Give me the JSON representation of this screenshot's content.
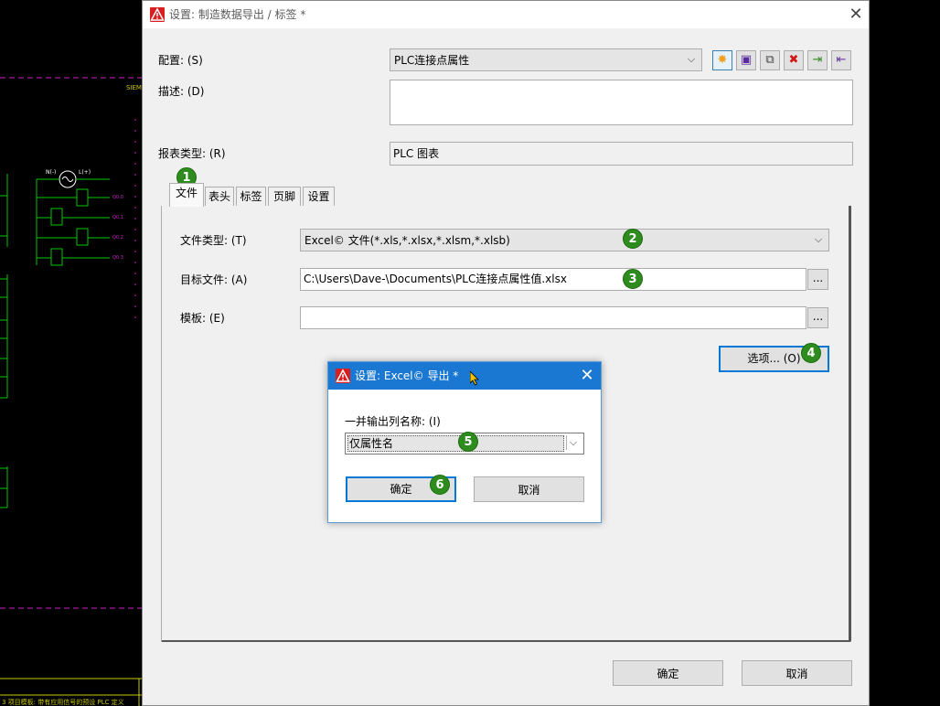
{
  "background": {
    "brand": "SIEM",
    "line_labels": [
      "N(-)",
      "L(+)",
      "Q0.0",
      "Q0.1",
      "Q0.2",
      "Q0.3"
    ],
    "status": "3 项目模板: 带有应用信号的预设 PLC 定义"
  },
  "main_window": {
    "title": "设置: 制造数据导出 / 标签 *",
    "config_label": "配置: (S)",
    "config_value": "PLC连接点属性",
    "toolbar": [
      {
        "name": "new-icon",
        "glyph": "✸",
        "color": "#f0a020"
      },
      {
        "name": "save-icon",
        "glyph": "▣",
        "color": "#5a2aa0"
      },
      {
        "name": "copy-icon",
        "glyph": "⧉",
        "color": "#444444"
      },
      {
        "name": "delete-icon",
        "glyph": "✖",
        "color": "#d01818"
      },
      {
        "name": "import-icon",
        "glyph": "⇥",
        "color": "#3a8a2a"
      },
      {
        "name": "export-icon",
        "glyph": "⇤",
        "color": "#6a3aa0"
      }
    ],
    "desc_label": "描述: (D)",
    "desc_value": "",
    "report_label": "报表类型: (R)",
    "report_value": "PLC 图表",
    "tabs": [
      "文件",
      "表头",
      "标签",
      "页脚",
      "设置"
    ],
    "file_type_label": "文件类型: (T)",
    "file_type_value": "Excel© 文件(*.xls,*.xlsx,*.xlsm,*.xlsb)",
    "target_label": "目标文件: (A)",
    "target_value": "C:\\Users\\Dave-\\Documents\\PLC连接点属性值.xlsx",
    "template_label": "模板: (E)",
    "template_value": "",
    "browse": "...",
    "options_button": "选项... (O)",
    "ok": "确定",
    "cancel": "取消"
  },
  "dialog": {
    "title": "设置: Excel© 导出 *",
    "output_label": "一并输出列名称: (I)",
    "output_value": "仅属性名",
    "ok": "确定",
    "cancel": "取消"
  },
  "badges": [
    "1",
    "2",
    "3",
    "4",
    "5",
    "6"
  ],
  "colors": {
    "badge": "#2e8b1e",
    "accent": "#0078d7",
    "dialog_title": "#1a78d2",
    "schematic_green": "#00c800",
    "schematic_magenta": "#d020d0"
  }
}
